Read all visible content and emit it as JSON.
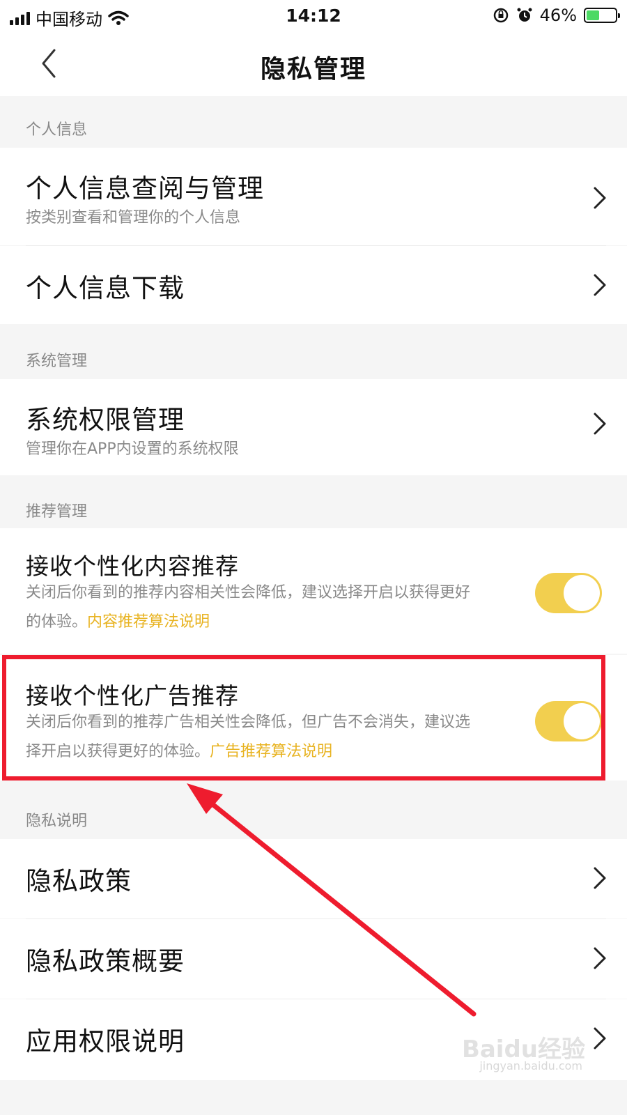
{
  "status_bar": {
    "carrier": "中国移动",
    "time": "14:12",
    "battery_percent": "46%",
    "battery_level": 0.46,
    "icons": [
      "signal-icon",
      "wifi-icon",
      "rotation-lock-icon",
      "alarm-icon",
      "battery-charging-icon"
    ]
  },
  "nav": {
    "title": "隐私管理",
    "back_icon": "chevron-left-icon"
  },
  "sections": {
    "personal_info": {
      "header": "个人信息",
      "items": [
        {
          "title": "个人信息查阅与管理",
          "subtitle": "按类别查看和管理你的个人信息"
        },
        {
          "title": "个人信息下载"
        }
      ]
    },
    "system": {
      "header": "系统管理",
      "items": [
        {
          "title": "系统权限管理",
          "subtitle": "管理你在APP内设置的系统权限"
        }
      ]
    },
    "recommend": {
      "header": "推荐管理",
      "items": [
        {
          "title": "接收个性化内容推荐",
          "desc": "关闭后你看到的推荐内容相关性会降低，建议选择开启以获得更好的体验。",
          "link": "内容推荐算法说明",
          "toggle_on": true
        },
        {
          "title": "接收个性化广告推荐",
          "desc": "关闭后你看到的推荐广告相关性会降低，但广告不会消失，建议选择开启以获得更好的体验。",
          "link": "广告推荐算法说明",
          "toggle_on": true
        }
      ]
    },
    "privacy": {
      "header": "隐私说明",
      "items": [
        {
          "title": "隐私政策"
        },
        {
          "title": "隐私政策概要"
        },
        {
          "title": "应用权限说明"
        }
      ]
    }
  },
  "watermark": {
    "main": "Baidu经验",
    "sub": "jingyan.baidu.com"
  },
  "colors": {
    "accent": "#f2cf4f",
    "link": "#e8b321",
    "annotation": "#ee1c2e"
  }
}
